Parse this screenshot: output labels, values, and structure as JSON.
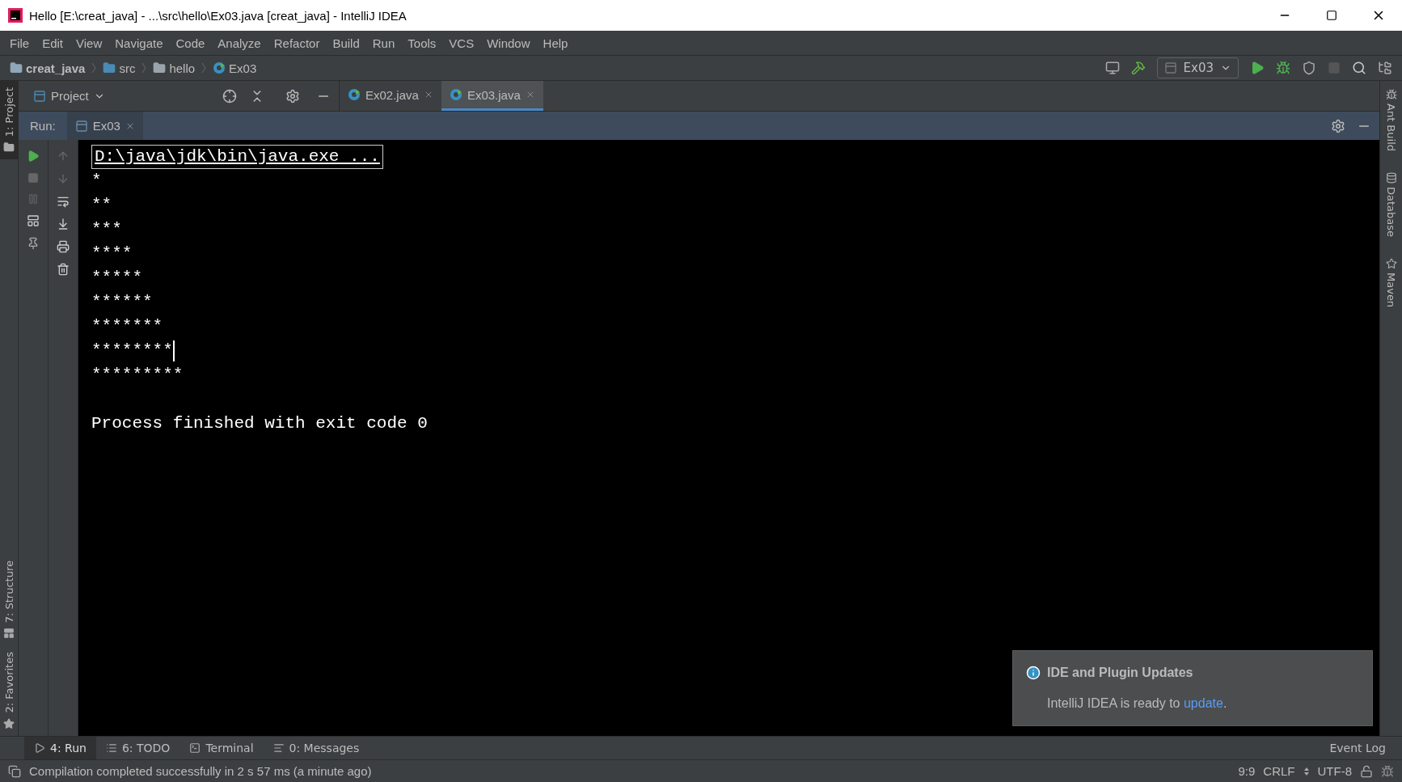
{
  "window": {
    "title": "Hello [E:\\creat_java] - ...\\src\\hello\\Ex03.java [creat_java] - IntelliJ IDEA"
  },
  "menu": [
    "File",
    "Edit",
    "View",
    "Navigate",
    "Code",
    "Analyze",
    "Refactor",
    "Build",
    "Run",
    "Tools",
    "VCS",
    "Window",
    "Help"
  ],
  "breadcrumbs": [
    {
      "label": "creat_java",
      "kind": "project"
    },
    {
      "label": "src",
      "kind": "folder"
    },
    {
      "label": "hello",
      "kind": "package"
    },
    {
      "label": "Ex03",
      "kind": "class"
    }
  ],
  "run_config": "Ex03",
  "project_panel": {
    "title": "Project"
  },
  "editor_tabs": [
    {
      "label": "Ex02.java",
      "selected": false
    },
    {
      "label": "Ex03.java",
      "selected": true
    }
  ],
  "run_panel": {
    "label": "Run:",
    "tab": "Ex03"
  },
  "console": {
    "command": "D:\\java\\jdk\\bin\\java.exe ...",
    "lines": [
      "*",
      "**",
      "***",
      "****",
      "*****",
      "******",
      "*******",
      "********",
      "*********"
    ],
    "footer": "Process finished with exit code 0"
  },
  "left_stripe": [
    {
      "label": "1: Project",
      "kind": "top"
    },
    {
      "label": "7: Structure",
      "kind": "bottom"
    },
    {
      "label": "2: Favorites",
      "kind": "bottom"
    }
  ],
  "right_stripe": [
    "Ant Build",
    "Database",
    "Maven"
  ],
  "bottom_tabs": [
    {
      "label": "4: Run",
      "selected": true
    },
    {
      "label": "6: TODO",
      "selected": false
    },
    {
      "label": "Terminal",
      "selected": false
    },
    {
      "label": "0: Messages",
      "selected": false
    }
  ],
  "event_log": "Event Log",
  "status": {
    "message": "Compilation completed successfully in 2 s 57 ms (a minute ago)",
    "position": "9:9",
    "line_separator": "CRLF",
    "encoding": "UTF-8"
  },
  "notification": {
    "title": "IDE and Plugin Updates",
    "text": "IntelliJ IDEA is ready to",
    "link": "update",
    "after": "."
  }
}
